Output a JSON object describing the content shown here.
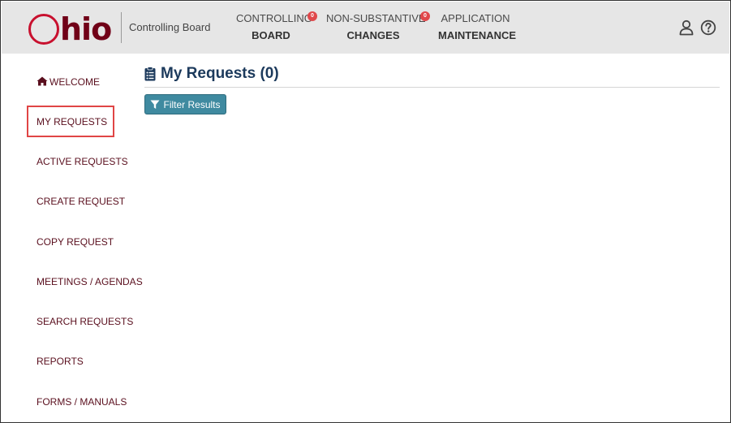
{
  "header": {
    "logo_text": "Ohio",
    "logo_rest": "hio",
    "agency": "Controlling Board",
    "nav": [
      {
        "line1": "CONTROLLING",
        "line2": "BOARD",
        "badge": "0"
      },
      {
        "line1": "NON-SUBSTANTIVE",
        "line2": "CHANGES",
        "badge": "0"
      },
      {
        "line1": "APPLICATION",
        "line2": "MAINTENANCE"
      }
    ],
    "icons": [
      "user-icon",
      "help-icon"
    ]
  },
  "sidebar": {
    "items": [
      {
        "label": "WELCOME",
        "icon": "home-icon"
      },
      {
        "label": "MY REQUESTS",
        "selected": true
      },
      {
        "label": "ACTIVE REQUESTS"
      },
      {
        "label": "CREATE REQUEST"
      },
      {
        "label": "COPY REQUEST"
      },
      {
        "label": "MEETINGS / AGENDAS"
      },
      {
        "label": "SEARCH REQUESTS"
      },
      {
        "label": "REPORTS"
      },
      {
        "label": "FORMS / MANUALS"
      }
    ]
  },
  "main": {
    "title": "My Requests (0)",
    "title_icon": "clipboard-list-icon",
    "filter_button": "Filter Results",
    "filter_icon": "filter-icon"
  },
  "colors": {
    "brand_red": "#c8102e",
    "brand_dark": "#700017",
    "header_bg": "#e6e6e6",
    "title_blue": "#1c3a5c",
    "button_teal": "#3f8aa0",
    "highlight": "#e04545",
    "badge": "#e0484b"
  }
}
